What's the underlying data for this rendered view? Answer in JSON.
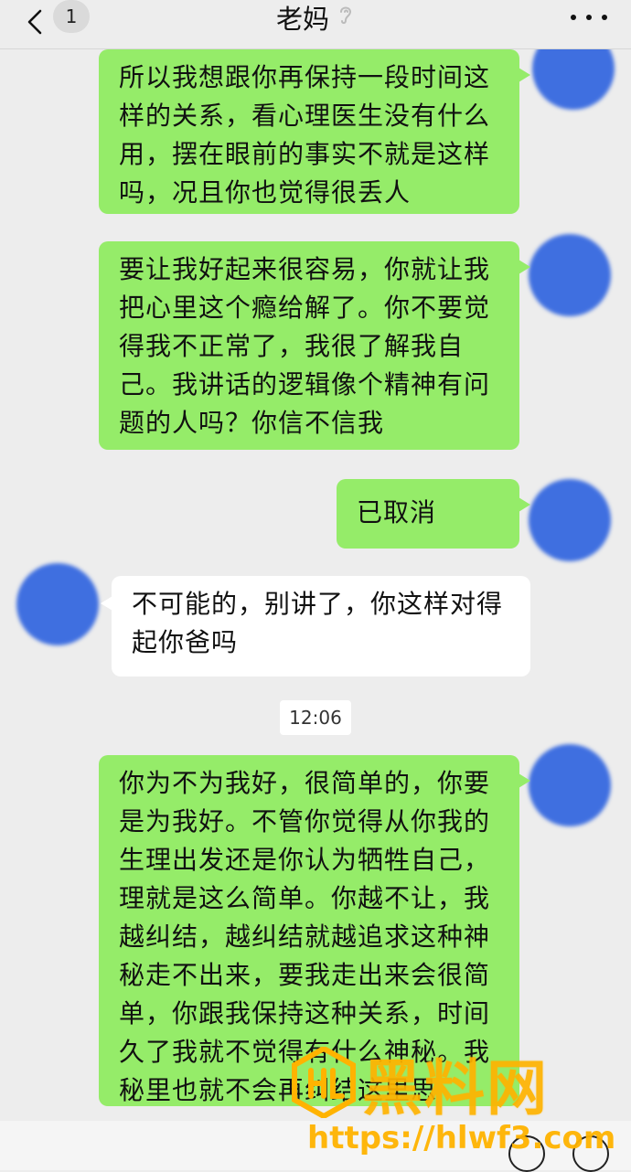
{
  "header": {
    "title": "老妈",
    "unread_count": "1",
    "back_icon": "chevron-left-icon",
    "ear_icon": "ear-icon",
    "more_icon": "more-dots-icon"
  },
  "messages": [
    {
      "from": "me",
      "text": "所以我想跟你再保持一段时间这样的关系，看心理医生没有什么用，摆在眼前的事实不就是这样吗，况且你也觉得很丢人"
    },
    {
      "from": "me",
      "text": "要让我好起来很容易，你就让我把心里这个瘾给解了。你不要觉得我不正常了，我很了解我自己。我讲话的逻辑像个精神有问题的人吗？你信不信我"
    },
    {
      "from": "me",
      "text": "已取消"
    },
    {
      "from": "other",
      "text": "不可能的，别讲了，你这样对得起你爸吗"
    },
    {
      "from": "me",
      "text": "你为不为我好，很简单的，你要是为我好。不管你觉得从你我的生理出发还是你认为牺牲自己，理就是这么简单。你越不让，我越纠结，越纠结就越追求这种神秘走不出来，要我走出来会很简单，你跟我保持这种关系，时间久了我就不觉得有什么神秘。我秘里也就不会再纠结这里思"
    }
  ],
  "timestamp": "12:06",
  "watermark": {
    "brand": "黑料网",
    "url": "https://hlwf3.com"
  },
  "colors": {
    "background": "#ededed",
    "my_bubble": "#95ec69",
    "other_bubble": "#ffffff",
    "avatar_blur": "#3f6fe0",
    "watermark": "#ffb300"
  }
}
